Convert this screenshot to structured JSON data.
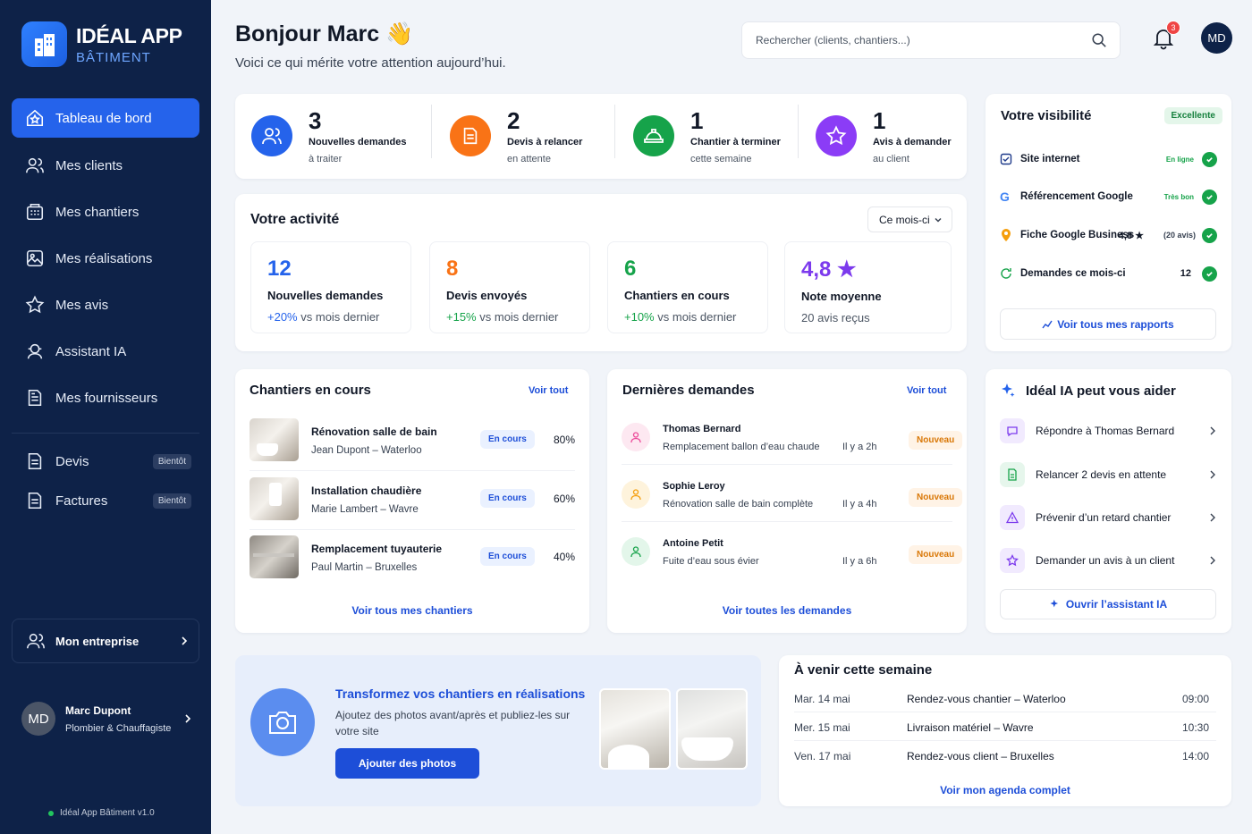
{
  "app": {
    "title": "IDÉAL APP",
    "subtitle": "BÂTIMENT",
    "version": "Idéal App Bâtiment v1.0"
  },
  "sidebar": {
    "items": [
      {
        "label": "Tableau de bord",
        "icon": "star-house-icon"
      },
      {
        "label": "Mes clients",
        "icon": "users-icon"
      },
      {
        "label": "Mes chantiers",
        "icon": "building-icon"
      },
      {
        "label": "Mes réalisations",
        "icon": "gallery-icon"
      },
      {
        "label": "Mes avis",
        "icon": "star-icon"
      },
      {
        "label": "Assistant IA",
        "icon": "assistant-icon"
      },
      {
        "label": "Mes fournisseurs",
        "icon": "document-icon"
      }
    ],
    "soon_items": [
      {
        "label": "Devis",
        "badge": "Bientôt"
      },
      {
        "label": "Factures",
        "badge": "Bientôt"
      }
    ],
    "company": "Mon entreprise",
    "user": {
      "initials": "MD",
      "name": "Marc Dupont",
      "role": "Plombier & Chauffagiste"
    }
  },
  "header": {
    "greeting": "Bonjour Marc 👋",
    "subtitle": "Voici ce qui mérite votre attention aujourd’hui.",
    "search_placeholder": "Rechercher (clients, chantiers...)",
    "notifications": "3",
    "avatar": "MD"
  },
  "kpis": [
    {
      "num": "3",
      "label": "Nouvelles demandes",
      "sub": "à traiter",
      "color": "#2563eb"
    },
    {
      "num": "2",
      "label": "Devis à relancer",
      "sub": "en attente",
      "color": "#f97316"
    },
    {
      "num": "1",
      "label": "Chantier à terminer",
      "sub": "cette semaine",
      "color": "#16a34a"
    },
    {
      "num": "1",
      "label": "Avis à demander",
      "sub": "au client",
      "color": "#8b3cf6"
    }
  ],
  "activity": {
    "title": "Votre activité",
    "period": "Ce mois-ci",
    "stats": [
      {
        "num": "12",
        "label": "Nouvelles demandes",
        "delta": "+20%",
        "sub": "vs mois dernier",
        "color": "#2563eb"
      },
      {
        "num": "8",
        "label": "Devis envoyés",
        "delta": "+15%",
        "sub": "vs mois dernier",
        "color": "#f97316"
      },
      {
        "num": "6",
        "label": "Chantiers en cours",
        "delta": "+10%",
        "sub": "vs mois dernier",
        "color": "#16a34a"
      },
      {
        "num": "4,8 ★",
        "label": "Note moyenne",
        "delta": "",
        "sub": "20 avis reçus",
        "color": "#7c3aed"
      }
    ]
  },
  "visibility": {
    "title": "Votre visibilité",
    "badge": "Excellente",
    "items": [
      {
        "label": "Site internet",
        "extra": "",
        "mini": "En ligne"
      },
      {
        "label": "Référencement Google",
        "extra": "",
        "mini": "Très bon"
      },
      {
        "label": "Fiche Google Business",
        "extra": "4,8 ★",
        "mini": "(20 avis)"
      },
      {
        "label": "Demandes ce mois-ci",
        "extra": "12",
        "mini": ""
      }
    ],
    "button": "Voir tous mes rapports"
  },
  "chantiers": {
    "title": "Chantiers en cours",
    "see_all": "Voir tout",
    "rows": [
      {
        "title": "Rénovation salle de bain",
        "sub": "Jean Dupont – Waterloo",
        "status": "En cours",
        "progress": "80%"
      },
      {
        "title": "Installation chaudière",
        "sub": "Marie Lambert – Wavre",
        "status": "En cours",
        "progress": "60%"
      },
      {
        "title": "Remplacement tuyauterie",
        "sub": "Paul Martin – Bruxelles",
        "status": "En cours",
        "progress": "40%"
      }
    ],
    "footer": "Voir tous mes chantiers"
  },
  "demandes": {
    "title": "Dernières demandes",
    "see_all": "Voir tout",
    "rows": [
      {
        "name": "Thomas Bernard",
        "sub": "Remplacement ballon d’eau chaude",
        "time": "Il y a 2h",
        "status": "Nouveau",
        "color": "#ec4899",
        "bg": "#fde8f1"
      },
      {
        "name": "Sophie Leroy",
        "sub": "Rénovation salle de bain complète",
        "time": "Il y a 4h",
        "status": "Nouveau",
        "color": "#f59e0b",
        "bg": "#fef3dc"
      },
      {
        "name": "Antoine Petit",
        "sub": "Fuite d’eau sous évier",
        "time": "Il y a 6h",
        "status": "Nouveau",
        "color": "#16a34a",
        "bg": "#e3f6ea"
      }
    ],
    "footer": "Voir toutes les demandes"
  },
  "ia": {
    "title": "Idéal IA peut vous aider",
    "items": [
      {
        "label": "Répondre à Thomas Bernard",
        "color": "#7c3aed",
        "bg": "#f1eafe"
      },
      {
        "label": "Relancer 2 devis en attente",
        "color": "#16a34a",
        "bg": "#e6f6ec"
      },
      {
        "label": "Prévenir d’un retard chantier",
        "color": "#7c3aed",
        "bg": "#f1eafe"
      },
      {
        "label": "Demander un avis à un client",
        "color": "#7c3aed",
        "bg": "#f1eafe"
      }
    ],
    "button": "Ouvrir l’assistant IA"
  },
  "promo": {
    "title": "Transformez vos chantiers en réalisations",
    "text": "Ajoutez des photos avant/après et publiez-les sur votre site",
    "button": "Ajouter des photos"
  },
  "agenda": {
    "title": "À venir cette semaine",
    "rows": [
      {
        "date": "Mar. 14 mai",
        "event": "Rendez-vous chantier – Waterloo",
        "time": "09:00"
      },
      {
        "date": "Mer. 15 mai",
        "event": "Livraison matériel – Wavre",
        "time": "10:30"
      },
      {
        "date": "Ven. 17 mai",
        "event": "Rendez-vous client – Bruxelles",
        "time": "14:00"
      }
    ],
    "footer": "Voir mon agenda complet"
  }
}
